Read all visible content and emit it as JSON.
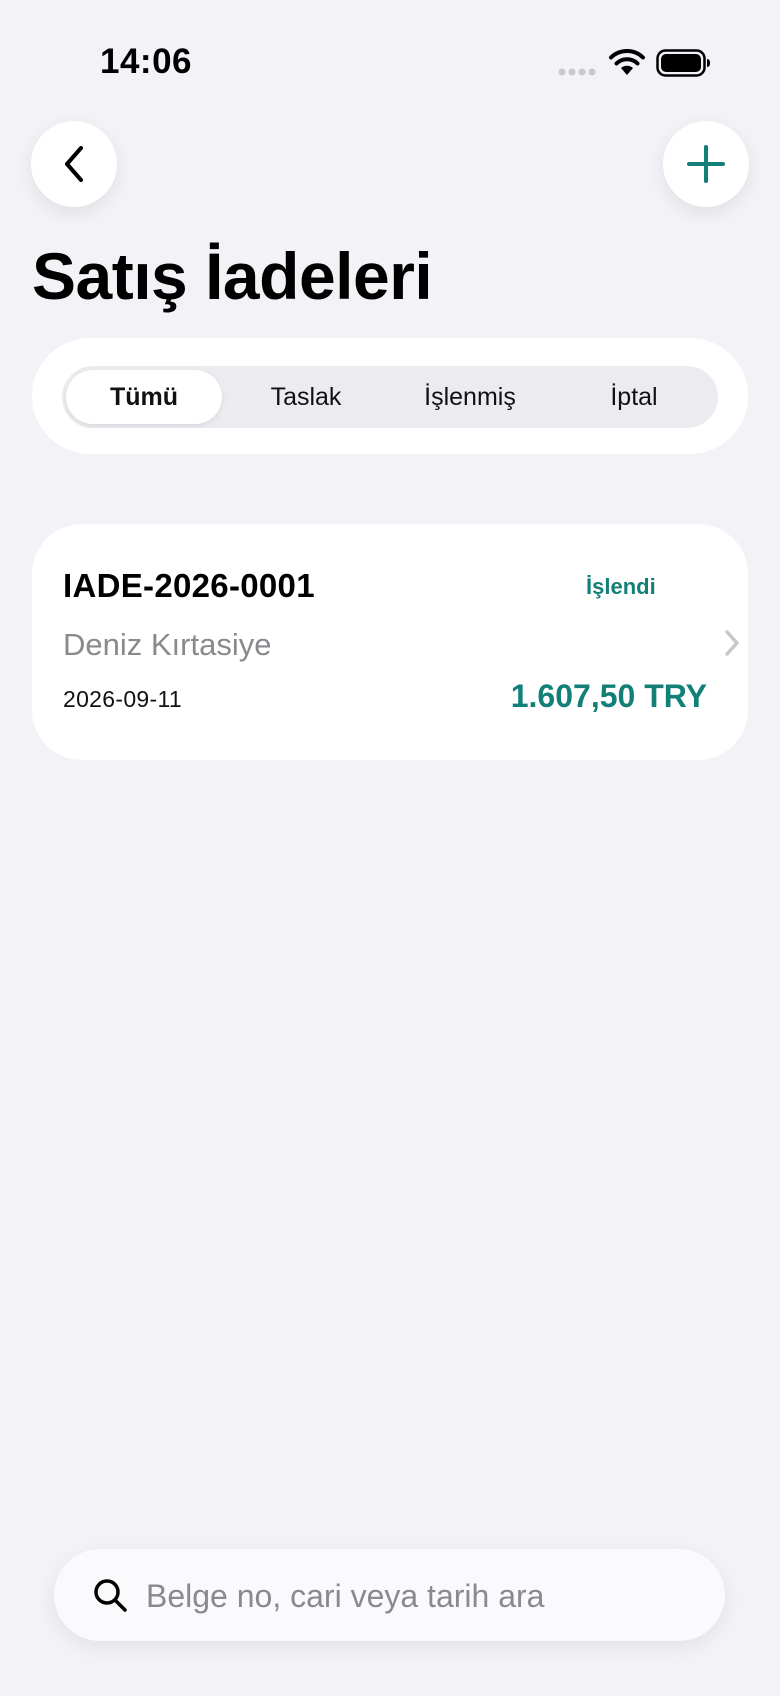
{
  "status_bar": {
    "time": "14:06"
  },
  "header": {
    "back_icon": "chevron-left-icon",
    "add_icon": "plus-icon",
    "title": "Satış İadeleri"
  },
  "filters": {
    "tabs": [
      {
        "label": "Tümü",
        "selected": true
      },
      {
        "label": "Taslak",
        "selected": false
      },
      {
        "label": "İşlenmiş",
        "selected": false
      },
      {
        "label": "İptal",
        "selected": false
      }
    ]
  },
  "returns": [
    {
      "doc_no": "IADE-2026-0001",
      "status": "İşlendi",
      "customer": "Deniz Kırtasiye",
      "date": "2026-09-11",
      "amount": "1.607,50 TRY"
    }
  ],
  "search": {
    "placeholder": "Belge no, cari veya tarih ara",
    "value": ""
  },
  "colors": {
    "accent": "#127f78",
    "background": "#f2f2f7",
    "secondary_text": "#8a8a8e"
  }
}
